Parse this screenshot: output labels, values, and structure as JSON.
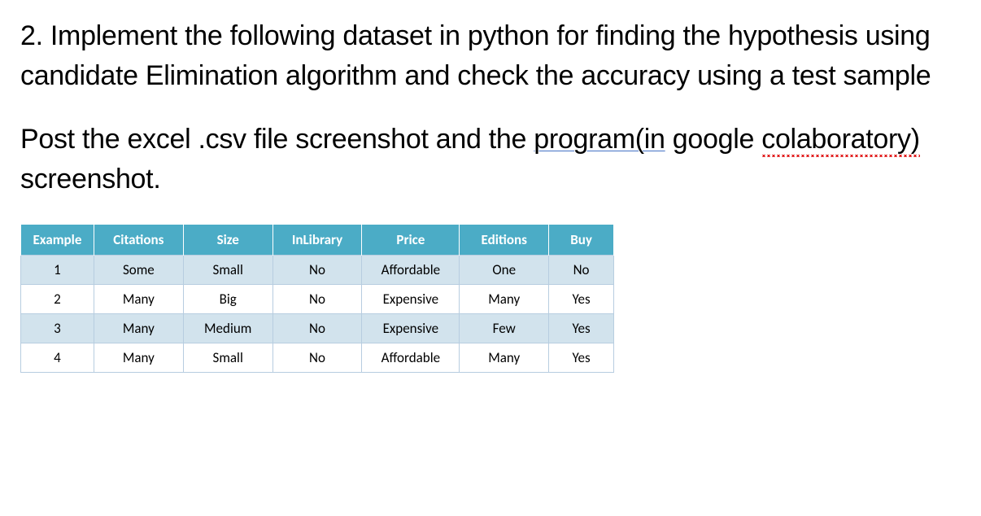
{
  "question": {
    "main_text": "2. Implement the following dataset in python for finding the hypothesis using candidate Elimination algorithm and check the accuracy using a test sample",
    "instruction_prefix": "Post the excel .csv file screenshot and the ",
    "instruction_underlined": "program(in",
    "instruction_middle": " google ",
    "instruction_squiggle": "colaboratory)",
    "instruction_suffix": " screenshot."
  },
  "table": {
    "headers": [
      "Example",
      "Citations",
      "Size",
      "InLibrary",
      "Price",
      "Editions",
      "Buy"
    ],
    "rows": [
      [
        "1",
        "Some",
        "Small",
        "No",
        "Affordable",
        "One",
        "No"
      ],
      [
        "2",
        "Many",
        "Big",
        "No",
        "Expensive",
        "Many",
        "Yes"
      ],
      [
        "3",
        "Many",
        "Medium",
        "No",
        "Expensive",
        "Few",
        "Yes"
      ],
      [
        "4",
        "Many",
        "Small",
        "No",
        "Affordable",
        "Many",
        "Yes"
      ]
    ]
  }
}
